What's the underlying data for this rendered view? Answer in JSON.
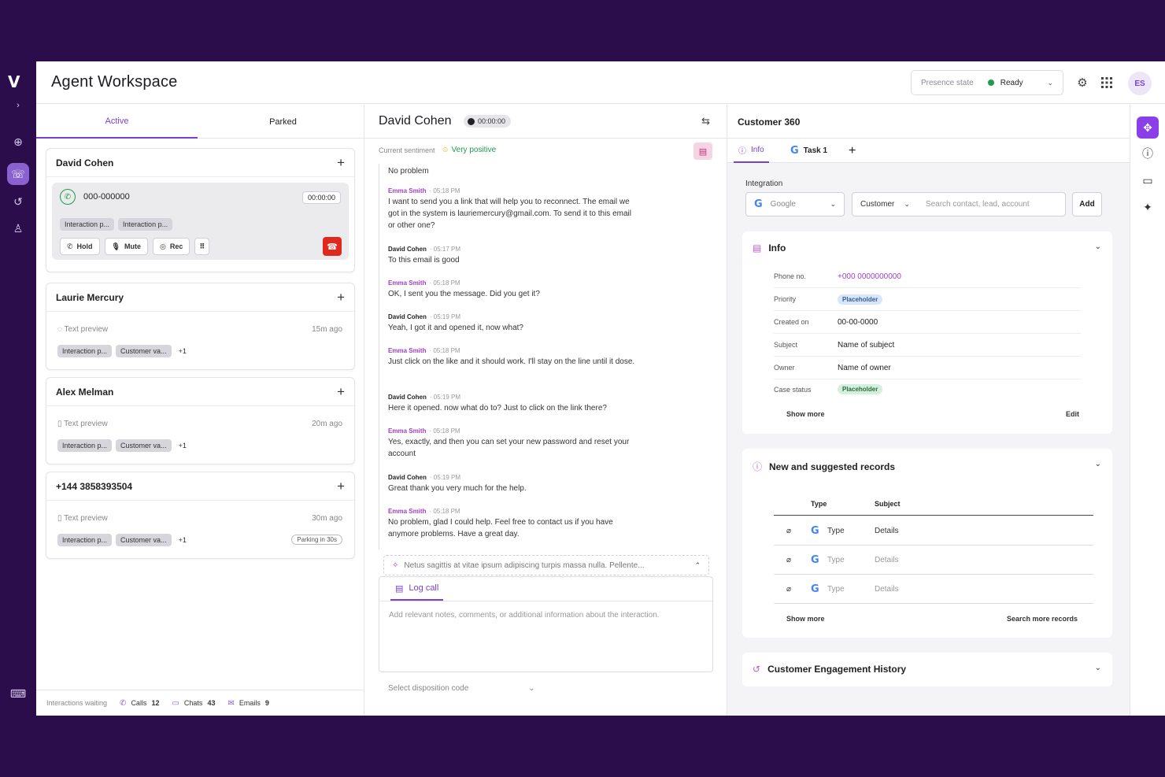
{
  "app": {
    "title": "Agent Workspace",
    "initials": "ES"
  },
  "presence": {
    "label": "Presence state",
    "value": "Ready"
  },
  "left": {
    "tabs": [
      "Active",
      "Parked"
    ],
    "active_call": {
      "name": "David Cohen",
      "number": "000-000000",
      "timer": "00:00:00",
      "chips": [
        "Interaction p...",
        "Interaction p..."
      ],
      "controls": {
        "hold": "Hold",
        "mute": "Mute",
        "rec": "Rec"
      }
    },
    "cards": [
      {
        "name": "Laurie Mercury",
        "preview": "Text preview",
        "ago": "15m ago",
        "chips": [
          "Interaction p...",
          "Customer va..."
        ],
        "more": "+1"
      },
      {
        "name": "Alex Melman",
        "preview": "Text preview",
        "ago": "20m ago",
        "chips": [
          "Interaction p...",
          "Customer va..."
        ],
        "more": "+1"
      },
      {
        "name": "+144 3858393504",
        "preview": "Text preview",
        "ago": "30m ago",
        "chips": [
          "Interaction p...",
          "Customer va..."
        ],
        "more": "+1",
        "parking": "Parking in 30s"
      }
    ],
    "waiting": {
      "label": "Interactions waiting",
      "calls_label": "Calls",
      "calls": "12",
      "chats_label": "Chats",
      "chats": "43",
      "emails_label": "Emails",
      "emails": "9"
    }
  },
  "middle": {
    "contact": "David Cohen",
    "timer": "00:00:00",
    "sentiment_label": "Current sentiment",
    "sentiment_value": "Very positive",
    "messages": [
      {
        "who": "",
        "time": "",
        "text": "No problem",
        "agent": false
      },
      {
        "who": "Emma Smith",
        "time": "· 05:18 PM",
        "text": "I want to send you a link that will help you to reconnect. The email we got in the system is lauriemercury@gmail.com. To send it to this email or other one?",
        "agent": true
      },
      {
        "who": "David Cohen",
        "time": "· 05:17 PM",
        "text": "To this email is good",
        "agent": false
      },
      {
        "who": "Emma Smith",
        "time": "· 05:18 PM",
        "text": "OK, I sent you the message. Did you get it?",
        "agent": true
      },
      {
        "who": "David Cohen",
        "time": "· 05:19 PM",
        "text": "Yeah, I got it and opened it, now what?",
        "agent": false
      },
      {
        "who": "Emma Smith",
        "time": "· 05:18 PM",
        "text": "Just click on the like and it should work. I'll stay on the line until it dose.",
        "agent": true
      },
      {
        "who": "David Cohen",
        "time": "· 05:19 PM",
        "text": "Here it opened. now what do to? Just to click on the link there?",
        "agent": false
      },
      {
        "who": "Emma Smith",
        "time": "· 05:18 PM",
        "text": "Yes, exactly, and then you can set your new password and reset your account",
        "agent": true
      },
      {
        "who": "David Cohen",
        "time": "· 05:19 PM",
        "text": "Great thank you very much for the help.",
        "agent": false
      },
      {
        "who": "Emma Smith",
        "time": "· 05:18 PM",
        "text": "No problem, glad I could help. Feel free to contact us if you have anymore problems. Have a great day.",
        "agent": true
      }
    ],
    "hint": "Netus sagittis at vitae ipsum adipiscing turpis massa nulla. Pellente...",
    "log_tab": "Log call",
    "notes_placeholder": "Add relevant notes, comments, or additional information about the interaction.",
    "disposition": "Select disposition code"
  },
  "right": {
    "title": "Customer 360",
    "tabs": [
      "Info",
      "Task 1"
    ],
    "integration_label": "Integration",
    "integration_value": "Google",
    "customer_select": "Customer",
    "search_placeholder": "Search contact, lead, account",
    "add": "Add",
    "info": {
      "title": "Info",
      "rows": [
        {
          "k": "Phone no.",
          "v": "+000 0000000000"
        },
        {
          "k": "Priority",
          "v": "Placeholder"
        },
        {
          "k": "Created on",
          "v": "00-00-0000"
        },
        {
          "k": "Subject",
          "v": "Name of subject"
        },
        {
          "k": "Owner",
          "v": "Name of owner"
        },
        {
          "k": "Case status",
          "v": "Placeholder"
        }
      ],
      "show_more": "Show more",
      "edit": "Edit"
    },
    "records": {
      "title": "New and suggested records",
      "col_type": "Type",
      "col_subject": "Subject",
      "rows": [
        {
          "type": "Type",
          "subject": "Details"
        },
        {
          "type": "Type",
          "subject": "Details"
        },
        {
          "type": "Type",
          "subject": "Details"
        }
      ],
      "show_more": "Show more",
      "search_more": "Search more records"
    },
    "history": {
      "title": "Customer Engagement History"
    }
  }
}
